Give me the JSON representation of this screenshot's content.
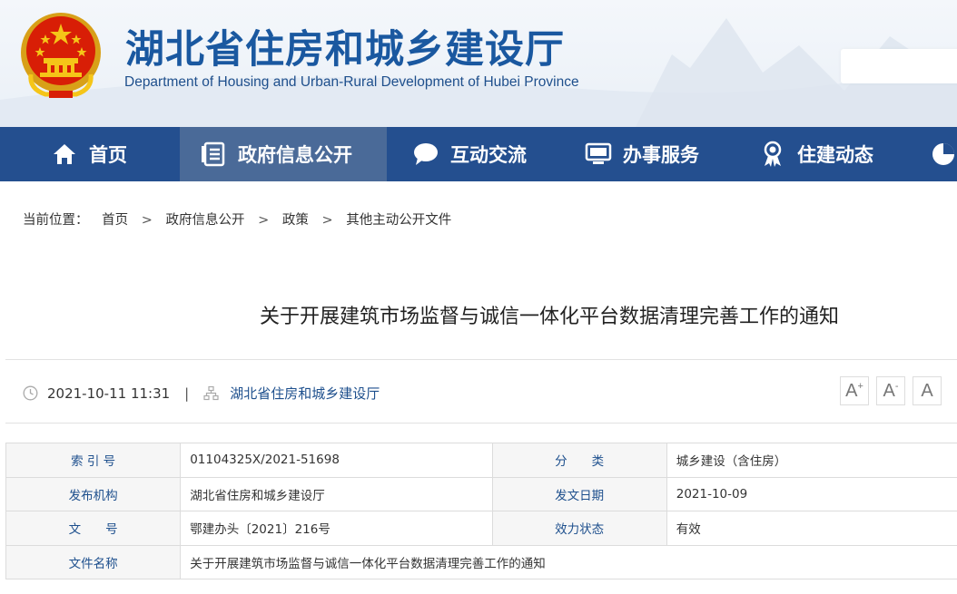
{
  "header": {
    "title": "湖北省住房和城乡建设厅",
    "subtitle": "Department of Housing and Urban-Rural Development of Hubei Province"
  },
  "nav": {
    "items": [
      {
        "label": "首页",
        "icon": "home-icon"
      },
      {
        "label": "政府信息公开",
        "icon": "document-list-icon",
        "active": true
      },
      {
        "label": "互动交流",
        "icon": "chat-bubble-icon"
      },
      {
        "label": "办事服务",
        "icon": "monitor-icon"
      },
      {
        "label": "住建动态",
        "icon": "award-icon"
      }
    ]
  },
  "breadcrumb": {
    "prefix": "当前位置：",
    "items": [
      "首页",
      "政府信息公开",
      "政策",
      "其他主动公开文件"
    ],
    "separator": ">"
  },
  "article": {
    "title": "关于开展建筑市场监督与诚信一体化平台数据清理完善工作的通知",
    "datetime": "2021-10-11 11:31",
    "meta_separator": "|",
    "source": "湖北省住房和城乡建设厅"
  },
  "font_size_controls": [
    "A",
    "A",
    "A"
  ],
  "info_table": {
    "rows": [
      {
        "label1": "索 引 号",
        "value1": "01104325X/2021-51698",
        "label2": "分　　类",
        "value2": "城乡建设（含住房）"
      },
      {
        "label1": "发布机构",
        "value1": "湖北省住房和城乡建设厅",
        "label2": "发文日期",
        "value2": "2021-10-09"
      },
      {
        "label1": "文　　号",
        "value1": "鄂建办头〔2021〕216号",
        "label2": "效力状态",
        "value2": "有效"
      }
    ],
    "last_row": {
      "label": "文件名称",
      "value": "关于开展建筑市场监督与诚信一体化平台数据清理完善工作的通知"
    }
  },
  "colors": {
    "brand_blue": "#1a58a0",
    "nav_bg": "#244f8f",
    "nav_active": "#4a6a98",
    "emblem_red": "#d81e06",
    "emblem_gold": "#f5c518"
  }
}
